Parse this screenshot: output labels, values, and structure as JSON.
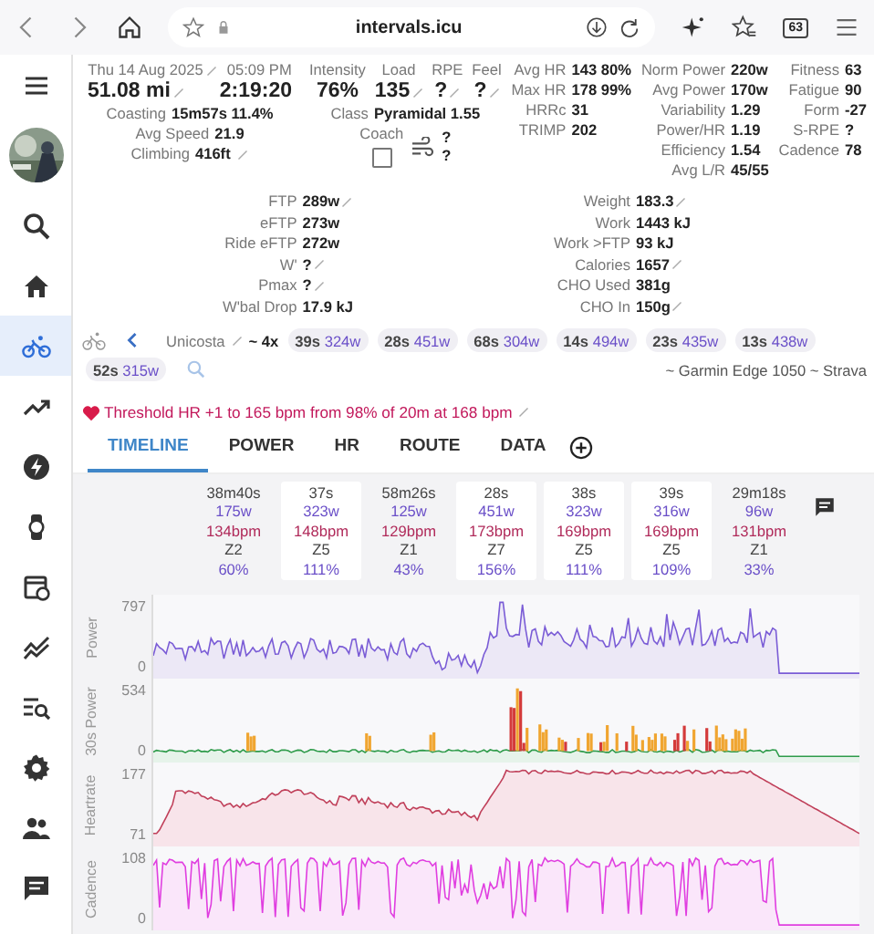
{
  "browser": {
    "url": "intervals.icu",
    "tab_count": "63"
  },
  "sidebar": {
    "items": [
      {
        "kind": "menu",
        "selected": false
      },
      {
        "kind": "avatar",
        "selected": false
      },
      {
        "kind": "search",
        "selected": false
      },
      {
        "kind": "home",
        "selected": false
      },
      {
        "kind": "bike",
        "selected": true
      },
      {
        "kind": "trend",
        "selected": false
      },
      {
        "kind": "bolt",
        "selected": false
      },
      {
        "kind": "watch",
        "selected": false
      },
      {
        "kind": "calendar",
        "selected": false
      },
      {
        "kind": "chart",
        "selected": false
      },
      {
        "kind": "list",
        "selected": false
      },
      {
        "kind": "gear",
        "selected": false
      },
      {
        "kind": "people",
        "selected": false
      },
      {
        "kind": "chat",
        "selected": false
      }
    ]
  },
  "col1": {
    "date": "Thu 14 Aug 2025",
    "time": "05:09 PM",
    "distance": "51.08 mi",
    "duration": "2:19:20",
    "stats": [
      {
        "label": "Coasting",
        "value": "15m57s 11.4%",
        "editable": false
      },
      {
        "label": "Avg Speed",
        "value": "21.9",
        "editable": false
      },
      {
        "label": "Climbing",
        "value": "416ft",
        "editable": true
      }
    ]
  },
  "col2": {
    "metrics": [
      {
        "label": "Intensity",
        "value": "76%",
        "editable": false
      },
      {
        "label": "Load",
        "value": "135",
        "editable": true
      },
      {
        "label": "RPE",
        "value": "?",
        "editable": true
      },
      {
        "label": "Feel",
        "value": "?",
        "editable": true
      }
    ],
    "class_label": "Class",
    "class_value": "Pyramidal 1.55",
    "coach_label": "Coach",
    "coach_checked": false,
    "wind": [
      "?",
      "?"
    ]
  },
  "hr_stats": [
    {
      "label": "Avg HR",
      "value": "143 80%"
    },
    {
      "label": "Max HR",
      "value": "178 99%"
    },
    {
      "label": "HRRc",
      "value": "31"
    },
    {
      "label": "TRIMP",
      "value": "202"
    }
  ],
  "power_stats": [
    {
      "label": "Norm Power",
      "value": "220w"
    },
    {
      "label": "Avg Power",
      "value": "170w"
    },
    {
      "label": "Variability",
      "value": "1.29"
    },
    {
      "label": "Power/HR",
      "value": "1.19"
    },
    {
      "label": "Efficiency",
      "value": "1.54"
    },
    {
      "label": "Avg L/R",
      "value": "45/55"
    }
  ],
  "fitness_stats": [
    {
      "label": "Fitness",
      "value": "63"
    },
    {
      "label": "Fatigue",
      "value": "90"
    },
    {
      "label": "Form",
      "value": "-27"
    },
    {
      "label": "S-RPE",
      "value": "?"
    },
    {
      "label": "Cadence",
      "value": "78"
    }
  ],
  "ftp_left": [
    {
      "label": "FTP",
      "value": "289w",
      "editable": true
    },
    {
      "label": "eFTP",
      "value": "273w",
      "editable": false
    },
    {
      "label": "Ride eFTP",
      "value": "272w",
      "editable": false
    },
    {
      "label": "W'",
      "value": "?",
      "editable": true
    },
    {
      "label": "Pmax",
      "value": "?",
      "editable": true
    },
    {
      "label": "W'bal Drop",
      "value": "17.9 kJ",
      "editable": false
    }
  ],
  "ftp_right": [
    {
      "label": "Weight",
      "value": "183.3",
      "editable": true
    },
    {
      "label": "Work",
      "value": "1443 kJ",
      "editable": false
    },
    {
      "label": "Work >FTP",
      "value": "93 kJ",
      "editable": false
    },
    {
      "label": "Calories",
      "value": "1657",
      "editable": true
    },
    {
      "label": "CHO Used",
      "value": "381g",
      "editable": false
    },
    {
      "label": "CHO In",
      "value": "150g",
      "editable": true
    }
  ],
  "intervals": {
    "name": "Unicosta",
    "summary": "~ 4x",
    "chips": [
      {
        "duration": "39s",
        "power": "324w"
      },
      {
        "duration": "28s",
        "power": "451w"
      },
      {
        "duration": "68s",
        "power": "304w"
      },
      {
        "duration": "14s",
        "power": "494w"
      },
      {
        "duration": "23s",
        "power": "435w"
      },
      {
        "duration": "13s",
        "power": "438w"
      },
      {
        "duration": "52s",
        "power": "315w"
      }
    ],
    "source": "~ Garmin Edge 1050 ~ Strava"
  },
  "threshold_note": "Threshold HR +1 to 165 bpm from 98% of 20m at 168 bpm",
  "tabs": [
    {
      "label": "TIMELINE",
      "selected": true
    },
    {
      "label": "POWER",
      "selected": false
    },
    {
      "label": "HR",
      "selected": false
    },
    {
      "label": "ROUTE",
      "selected": false
    },
    {
      "label": "DATA",
      "selected": false
    }
  ],
  "segments": [
    {
      "duration": "38m40s",
      "power": "175w",
      "hr": "134bpm",
      "zone": "Z2",
      "percent": "60%",
      "highlighted": false
    },
    {
      "duration": "37s",
      "power": "323w",
      "hr": "148bpm",
      "zone": "Z5",
      "percent": "111%",
      "highlighted": true
    },
    {
      "duration": "58m26s",
      "power": "125w",
      "hr": "129bpm",
      "zone": "Z1",
      "percent": "43%",
      "highlighted": false
    },
    {
      "duration": "28s",
      "power": "451w",
      "hr": "173bpm",
      "zone": "Z7",
      "percent": "156%",
      "highlighted": true
    },
    {
      "duration": "38s",
      "power": "323w",
      "hr": "169bpm",
      "zone": "Z5",
      "percent": "111%",
      "highlighted": true
    },
    {
      "duration": "39s",
      "power": "316w",
      "hr": "169bpm",
      "zone": "Z5",
      "percent": "109%",
      "highlighted": true
    },
    {
      "duration": "29m18s",
      "power": "96w",
      "hr": "131bpm",
      "zone": "Z1",
      "percent": "33%",
      "highlighted": false
    }
  ],
  "charts": [
    {
      "kind": "power",
      "label": "Power",
      "max": "797",
      "min": "0"
    },
    {
      "kind": "smooth",
      "label": "30s Power",
      "max": "534",
      "min": "0"
    },
    {
      "kind": "hr",
      "label": "Heartrate",
      "max": "177",
      "min": "71"
    },
    {
      "kind": "cadence",
      "label": "Cadence",
      "max": "108",
      "min": "0"
    }
  ]
}
